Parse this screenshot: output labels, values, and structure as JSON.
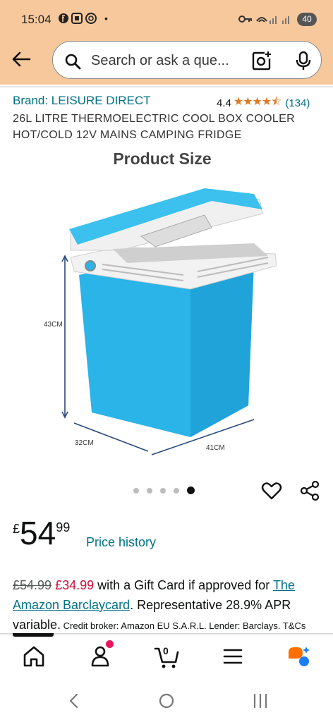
{
  "status_bar": {
    "time": "15:04",
    "battery": "40",
    "dot": "•"
  },
  "search": {
    "placeholder": "Search or ask a que..."
  },
  "product": {
    "brand": "Brand: LEISURE DIRECT",
    "rating": "4.4",
    "stars": "★★★★⯪",
    "review_count": "(134)",
    "title": "26L LITRE THERMOELECTRIC COOL BOX COOLER HOT/COLD 12V MAINS CAMPING FRIDGE",
    "image": {
      "heading": "Product Size",
      "height_label": "43CM",
      "depth_label": "32CM",
      "width_label": "41CM"
    },
    "carousel": {
      "count": 5,
      "active_index": 4
    }
  },
  "price": {
    "symbol": "£",
    "whole": "54",
    "fraction": "99",
    "history_link": "Price history"
  },
  "offer": {
    "old_price": "£54.99",
    "new_price": "£34.99",
    "text1": " with a Gift Card if approved for ",
    "link1": "The",
    "link2": "Amazon Barclaycard",
    "text2": ". Representative 28.9% APR variable.",
    "small": " Credit broker: Amazon EU S.A.R.L. Lender: Barclays. T&Cs"
  },
  "bottom_nav": {
    "cart_count": "0",
    "items": [
      "home-icon",
      "account-icon",
      "cart-icon",
      "menu-icon",
      "rufus-icon"
    ]
  },
  "colors": {
    "header_bg": "#f6c89c",
    "link": "#007185",
    "deal": "#cc0c39",
    "star": "#de7921",
    "cooler_blue": "#2ab4e8"
  }
}
